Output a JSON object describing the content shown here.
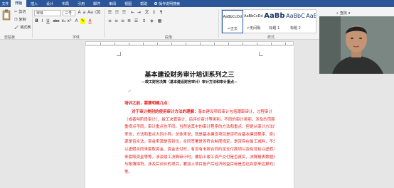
{
  "tabs": {
    "file": "文件",
    "items": [
      "开始",
      "插入",
      "设计",
      "布局",
      "引用",
      "邮件",
      "审阅",
      "视图",
      "帮助"
    ],
    "active_index": 0,
    "tell_me": "操作说明搜索"
  },
  "clipboard": {
    "cut": "剪切",
    "copy": "复制",
    "format_painter": "格式刷",
    "group_label": "剪贴板"
  },
  "font": {
    "name": "宋体",
    "size": "三号",
    "bold": "B",
    "italic": "I",
    "underline": "U",
    "strike": "abc",
    "subscript": "x₂",
    "superscript": "x²",
    "font_color_glyph": "A",
    "group_label": "字体"
  },
  "paragraph": {
    "group_label": "段落"
  },
  "styles": {
    "group_label": "样式",
    "items": [
      {
        "sample": "AaBbCcDd",
        "name": "↵正文",
        "kind": "small"
      },
      {
        "sample": "AaBbCcDd",
        "name": "↵无间隔",
        "kind": "small"
      },
      {
        "sample": "AaBb",
        "name": "标题 1",
        "kind": "big"
      },
      {
        "sample": "AaBbC",
        "name": "标题 2",
        "kind": "mid"
      },
      {
        "sample": "AaBbC",
        "name": "",
        "kind": "mid"
      }
    ]
  },
  "editing": {
    "find": "查找"
  },
  "document": {
    "title": "基本建设财务审计培训系列之三",
    "subtitle": "—竣工财务决算（基本建设财务审计）审计方法和审计重点—",
    "section_heading": "培训之前，需要明确几点：",
    "paragraph_lead": "对于审计类别的使用审计方法的理解：",
    "lines": [
      "基本建设项目审计包括跟踪审计、过程审计",
      "（或者叫阶段审计）、竣工决算审计、后评价审计等类别。不同的审计类别，涉及的范围和",
      "重视点不同，审计重点也不同。当然这其中的审计程序的方法和重点，但是从审计方法的",
      "来说，方法和重点大同小异。总体来说，就是基本建设项目是否符合基本建设程序、资金来",
      "源是否合法，资金来源是否到位，合同签署是否符合制度规定，是否存在偷工减料，不是否",
      "以虚假合同来套取资金、资金支付时，有没有未按合同约定支付款项以及有没有以虚假发票",
      "来套取资金等等。涉及竣工决算审计时，要加上竣工资产交付是否真实，决算报表数据是否",
      "与账簿相符。涉及后评价的项目，要加上项目投产后经济效益目标是否达到原来估算的水平",
      "等。"
    ]
  },
  "colors": {
    "ribbon_blue": "#2b579a",
    "doc_red": "#e0201d"
  }
}
